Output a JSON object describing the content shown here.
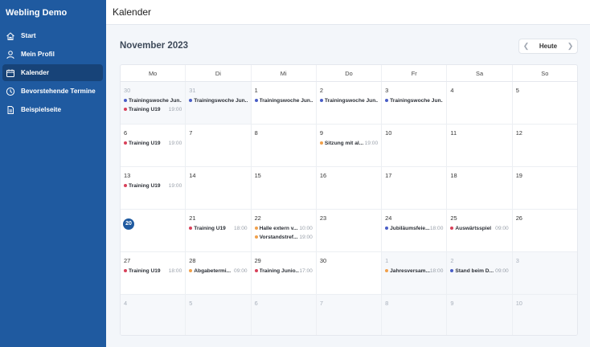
{
  "app": {
    "title": "Webling Demo"
  },
  "sidebar": {
    "items": [
      {
        "label": "Start",
        "icon": "home-icon",
        "active": false
      },
      {
        "label": "Mein Profil",
        "icon": "user-icon",
        "active": false
      },
      {
        "label": "Kalender",
        "icon": "calendar-icon",
        "active": true
      },
      {
        "label": "Bevorstehende Termine",
        "icon": "clock-icon",
        "active": false
      },
      {
        "label": "Beispielseite",
        "icon": "document-icon",
        "active": false
      }
    ]
  },
  "topbar": {
    "title": "Kalender"
  },
  "calendar": {
    "month_title": "November 2023",
    "today_label": "Heute",
    "weekdays": [
      "Mo",
      "Di",
      "Mi",
      "Do",
      "Fr",
      "Sa",
      "So"
    ],
    "colors": {
      "blue": "#4a5ec7",
      "red": "#d8415a",
      "orange": "#f0a04b",
      "today": "#1f5aa0"
    },
    "weeks": [
      [
        {
          "day": "30",
          "other": true,
          "events": [
            {
              "title": "Trainingswoche Jun...",
              "time": "",
              "color": "blue"
            },
            {
              "title": "Training U19",
              "time": "19:00",
              "color": "red"
            }
          ]
        },
        {
          "day": "31",
          "other": true,
          "events": [
            {
              "title": "Trainingswoche Jun...",
              "time": "",
              "color": "blue"
            }
          ]
        },
        {
          "day": "1",
          "events": [
            {
              "title": "Trainingswoche Jun...",
              "time": "",
              "color": "blue"
            }
          ]
        },
        {
          "day": "2",
          "events": [
            {
              "title": "Trainingswoche Jun...",
              "time": "",
              "color": "blue"
            }
          ]
        },
        {
          "day": "3",
          "events": [
            {
              "title": "Trainingswoche Jun...",
              "time": "",
              "color": "blue"
            }
          ]
        },
        {
          "day": "4",
          "events": []
        },
        {
          "day": "5",
          "events": []
        }
      ],
      [
        {
          "day": "6",
          "events": [
            {
              "title": "Training U19",
              "time": "19:00",
              "color": "red"
            }
          ]
        },
        {
          "day": "7",
          "events": []
        },
        {
          "day": "8",
          "events": []
        },
        {
          "day": "9",
          "events": [
            {
              "title": "Sitzung mit al...",
              "time": "19:00",
              "color": "orange"
            }
          ]
        },
        {
          "day": "10",
          "events": []
        },
        {
          "day": "11",
          "events": []
        },
        {
          "day": "12",
          "events": []
        }
      ],
      [
        {
          "day": "13",
          "events": [
            {
              "title": "Training U19",
              "time": "19:00",
              "color": "red"
            }
          ]
        },
        {
          "day": "14",
          "events": []
        },
        {
          "day": "15",
          "events": []
        },
        {
          "day": "16",
          "events": []
        },
        {
          "day": "17",
          "events": []
        },
        {
          "day": "18",
          "events": []
        },
        {
          "day": "19",
          "events": []
        }
      ],
      [
        {
          "day": "20",
          "today": true,
          "events": []
        },
        {
          "day": "21",
          "events": [
            {
              "title": "Training U19",
              "time": "18:00",
              "color": "red"
            }
          ]
        },
        {
          "day": "22",
          "events": [
            {
              "title": "Halle extern v...",
              "time": "10:00",
              "color": "orange"
            },
            {
              "title": "Vorstandstref...",
              "time": "19:00",
              "color": "orange"
            }
          ]
        },
        {
          "day": "23",
          "events": []
        },
        {
          "day": "24",
          "events": [
            {
              "title": "Jubiläumsfeie...",
              "time": "18:00",
              "color": "blue"
            }
          ]
        },
        {
          "day": "25",
          "events": [
            {
              "title": "Auswärtsspiel",
              "time": "09:00",
              "color": "red"
            }
          ]
        },
        {
          "day": "26",
          "events": []
        }
      ],
      [
        {
          "day": "27",
          "events": [
            {
              "title": "Training U19",
              "time": "18:00",
              "color": "red"
            }
          ]
        },
        {
          "day": "28",
          "events": [
            {
              "title": "Abgabetermi...",
              "time": "09:00",
              "color": "orange"
            }
          ]
        },
        {
          "day": "29",
          "events": [
            {
              "title": "Training Junio...",
              "time": "17:00",
              "color": "red"
            }
          ]
        },
        {
          "day": "30",
          "events": []
        },
        {
          "day": "1",
          "other": true,
          "events": [
            {
              "title": "Jahresversam...",
              "time": "18:00",
              "color": "orange"
            }
          ]
        },
        {
          "day": "2",
          "other": true,
          "events": [
            {
              "title": "Stand beim D...",
              "time": "09:00",
              "color": "blue"
            }
          ]
        },
        {
          "day": "3",
          "other": true,
          "events": []
        }
      ],
      [
        {
          "day": "4",
          "other": true,
          "events": []
        },
        {
          "day": "5",
          "other": true,
          "events": []
        },
        {
          "day": "6",
          "other": true,
          "events": []
        },
        {
          "day": "7",
          "other": true,
          "events": []
        },
        {
          "day": "8",
          "other": true,
          "events": []
        },
        {
          "day": "9",
          "other": true,
          "events": []
        },
        {
          "day": "10",
          "other": true,
          "events": []
        }
      ]
    ]
  }
}
